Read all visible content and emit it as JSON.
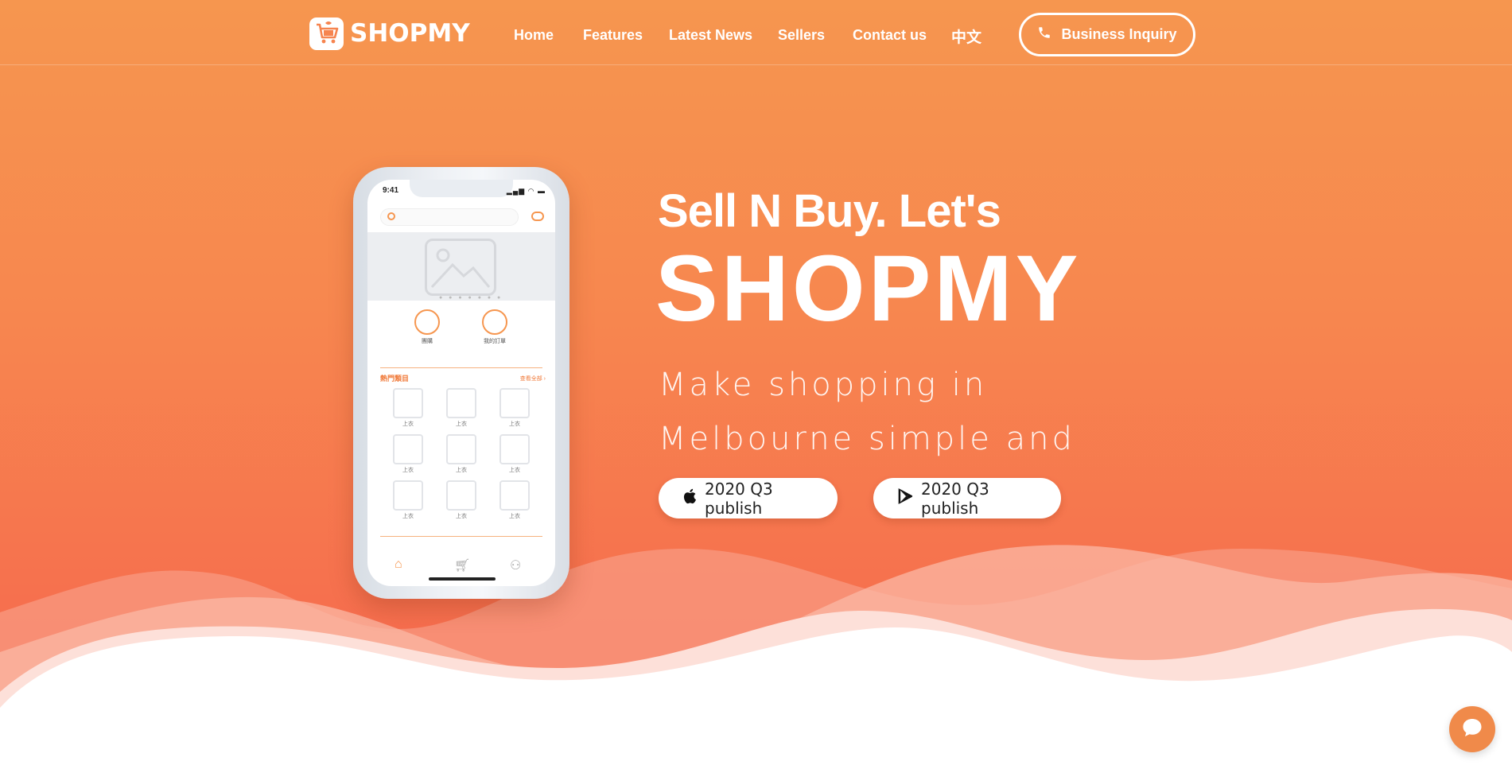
{
  "brand": {
    "name": "SHOPMY",
    "logo_icon": "shopping-cart-logo-icon"
  },
  "nav": {
    "items": [
      {
        "label": "Home"
      },
      {
        "label": "Features"
      },
      {
        "label": "Latest News"
      },
      {
        "label": "Sellers"
      },
      {
        "label": "Contact us"
      },
      {
        "label": "中文"
      }
    ],
    "inquiry_label": "Business Inquiry",
    "inquiry_icon": "phone-icon"
  },
  "hero": {
    "subtitle": "Sell N Buy. Let's",
    "title": "SHOPMY",
    "tagline": "Make shopping in Melbourne simple and efficient.",
    "apple_button": {
      "label": "2020 Q3 publish",
      "icon": "apple-icon"
    },
    "google_button": {
      "label": "2020 Q3 publish",
      "icon": "google-play-icon"
    }
  },
  "phone": {
    "time": "9:41",
    "quick_actions": [
      {
        "label": "團購"
      },
      {
        "label": "我的訂單"
      }
    ],
    "hot_section": "熱門類目",
    "see_all": "查看全部 ›",
    "item_label": "上衣"
  },
  "colors": {
    "accent": "#f6964f",
    "accent_dark": "#f66c4e",
    "white": "#ffffff"
  },
  "chat_widget": {
    "icon": "chat-bubble-icon"
  }
}
